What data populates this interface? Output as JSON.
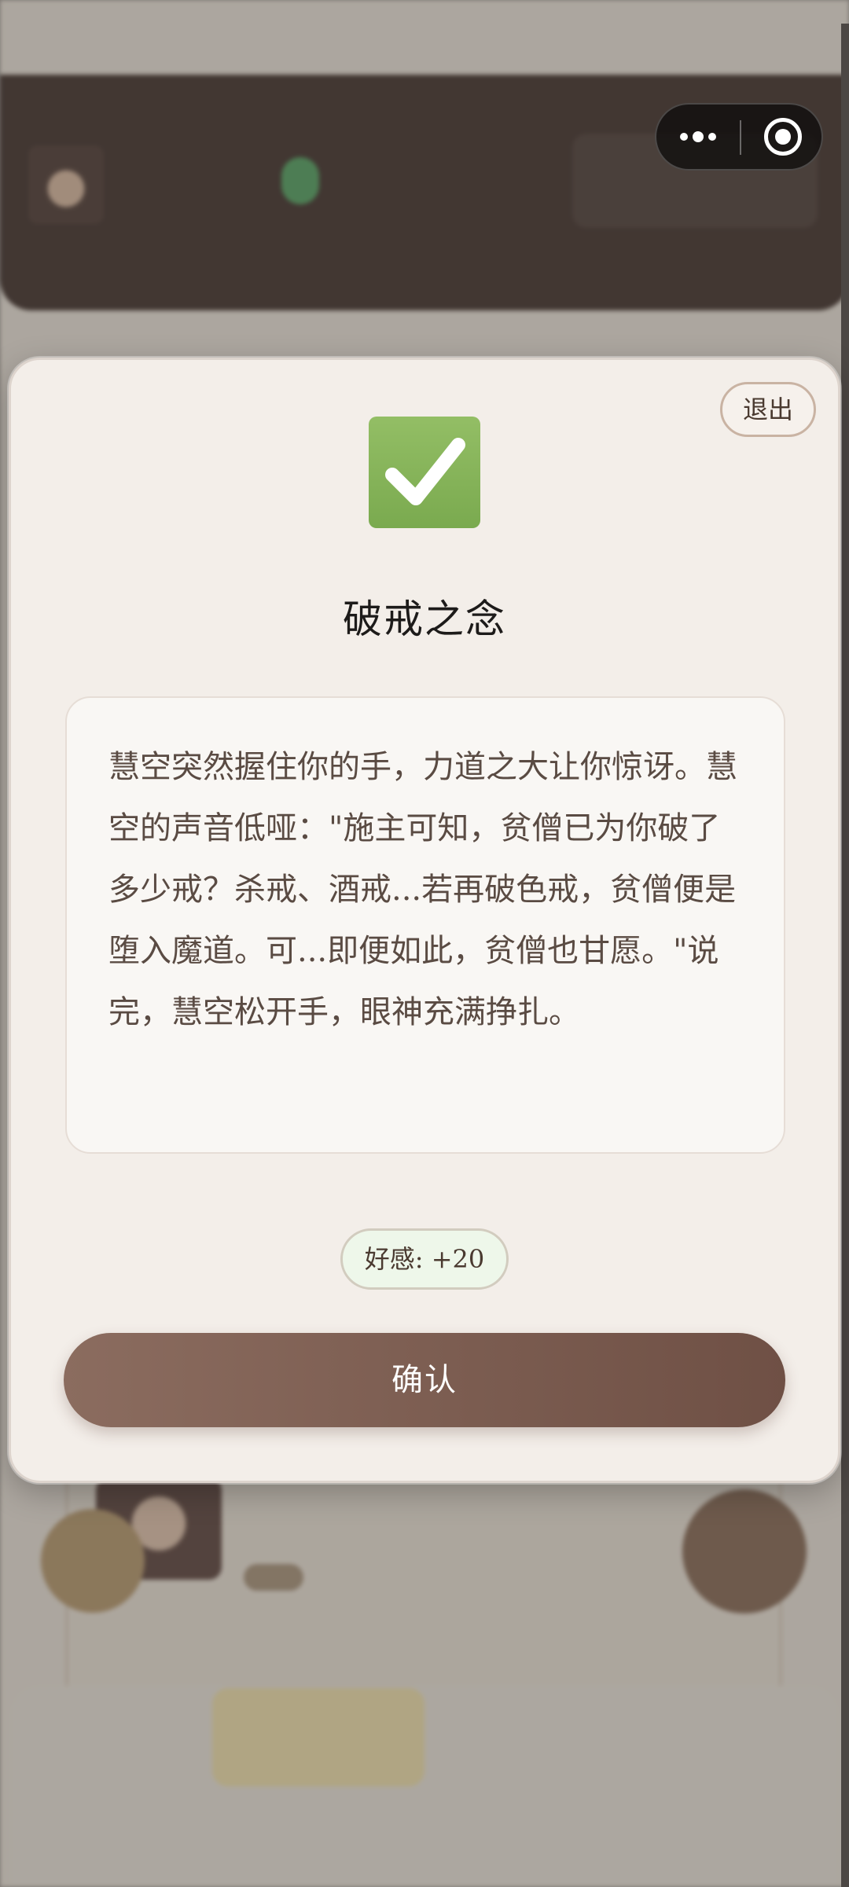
{
  "modal": {
    "exit_label": "退出",
    "icon": "white-check-mark-icon",
    "title": "破戒之念",
    "story": "慧空突然握住你的手，力道之大让你惊讶。慧空的声音低哑：\"施主可知，贫僧已为你破了多少戒？杀戒、酒戒...若再破色戒，贫僧便是堕入魔道。可...即便如此，贫僧也甘愿。\"说完，慧空松开手，眼神充满挣扎。",
    "favor": "好感: +20",
    "confirm_label": "确认"
  },
  "capsule": {
    "menu_icon": "more-dots-icon",
    "close_icon": "target-circle-icon"
  },
  "colors": {
    "accent_button": "#7a5a4e",
    "modal_bg": "#f3eee9",
    "check_green": "#86b45a",
    "favor_bg": "#eef7ea"
  }
}
